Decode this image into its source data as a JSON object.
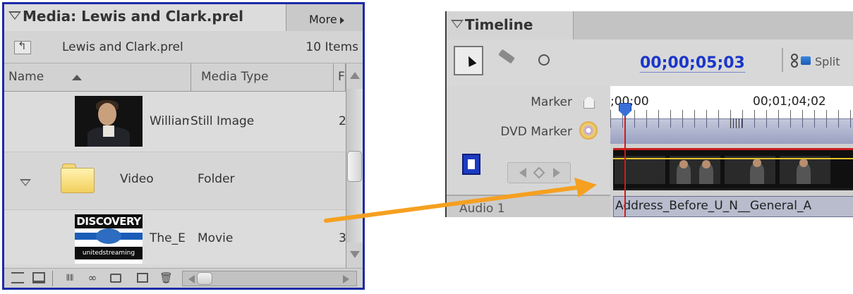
{
  "media_panel": {
    "title": "Media: Lewis and Clark.prel",
    "more_label": "More",
    "project_name": "Lewis and Clark.prel",
    "items_count": "10 Items",
    "columns": {
      "name": "Name",
      "media_type": "Media Type",
      "third": "F"
    },
    "rows": [
      {
        "name": "William",
        "media_type": "Still Image",
        "extra": "2"
      },
      {
        "name": "Video",
        "media_type": "Folder",
        "extra": ""
      },
      {
        "name": "The_E",
        "media_type": "Movie",
        "extra": "3"
      }
    ],
    "movie_thumb": {
      "brand": "DISCOVERY",
      "sub": "unitedstreaming"
    }
  },
  "timeline_panel": {
    "title": "Timeline",
    "timecode": "00;00;05;03",
    "split_label": "Split",
    "track_labels": {
      "marker": "Marker",
      "dvd_marker": "DVD Marker",
      "audio": "Audio 1"
    },
    "ruler": {
      "start": ";00;00",
      "mid": "00;01;04;02"
    },
    "audio_clip_name": "Address_Before_U_N__General_A"
  },
  "colors": {
    "panel_border": "#1c2aa6",
    "timecode": "#1a36c9",
    "playhead": "#d11a1a",
    "annotation_arrow": "#f5a020"
  }
}
